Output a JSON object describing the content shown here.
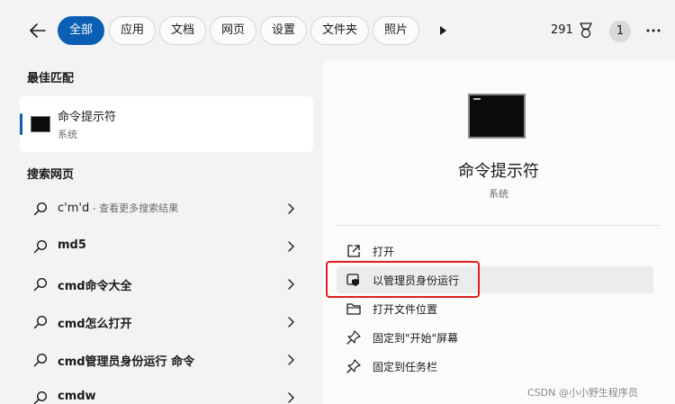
{
  "header": {
    "filters": [
      {
        "label": "全部",
        "active": true
      },
      {
        "label": "应用",
        "active": false
      },
      {
        "label": "文档",
        "active": false
      },
      {
        "label": "网页",
        "active": false
      },
      {
        "label": "设置",
        "active": false
      },
      {
        "label": "文件夹",
        "active": false
      },
      {
        "label": "照片",
        "active": false
      }
    ],
    "points": "291",
    "avatar_initial": "1"
  },
  "left": {
    "best_match_title": "最佳匹配",
    "best_match": {
      "title": "命令提示符",
      "subtitle": "系统"
    },
    "web_title": "搜索网页",
    "web_results": [
      {
        "text": "c'm'd",
        "note": " - 查看更多搜索结果"
      },
      {
        "text": "md5",
        "note": ""
      },
      {
        "text": "cmd命令大全",
        "note": ""
      },
      {
        "text": "cmd怎么打开",
        "note": ""
      },
      {
        "text": "cmd管理员身份运行 命令",
        "note": ""
      },
      {
        "text": "cmdw",
        "note": ""
      }
    ]
  },
  "right": {
    "app_name": "命令提示符",
    "app_type": "系统",
    "actions": [
      {
        "label": "打开",
        "icon": "open-external-icon"
      },
      {
        "label": "以管理员身份运行",
        "icon": "shield-icon"
      },
      {
        "label": "打开文件位置",
        "icon": "folder-icon"
      },
      {
        "label": "固定到\"开始\"屏幕",
        "icon": "pin-icon"
      },
      {
        "label": "固定到任务栏",
        "icon": "pin-icon"
      }
    ]
  },
  "watermark": "CSDN @小小野生程序员",
  "colors": {
    "accent": "#0a5fb5",
    "highlight_box": "#e02020"
  }
}
